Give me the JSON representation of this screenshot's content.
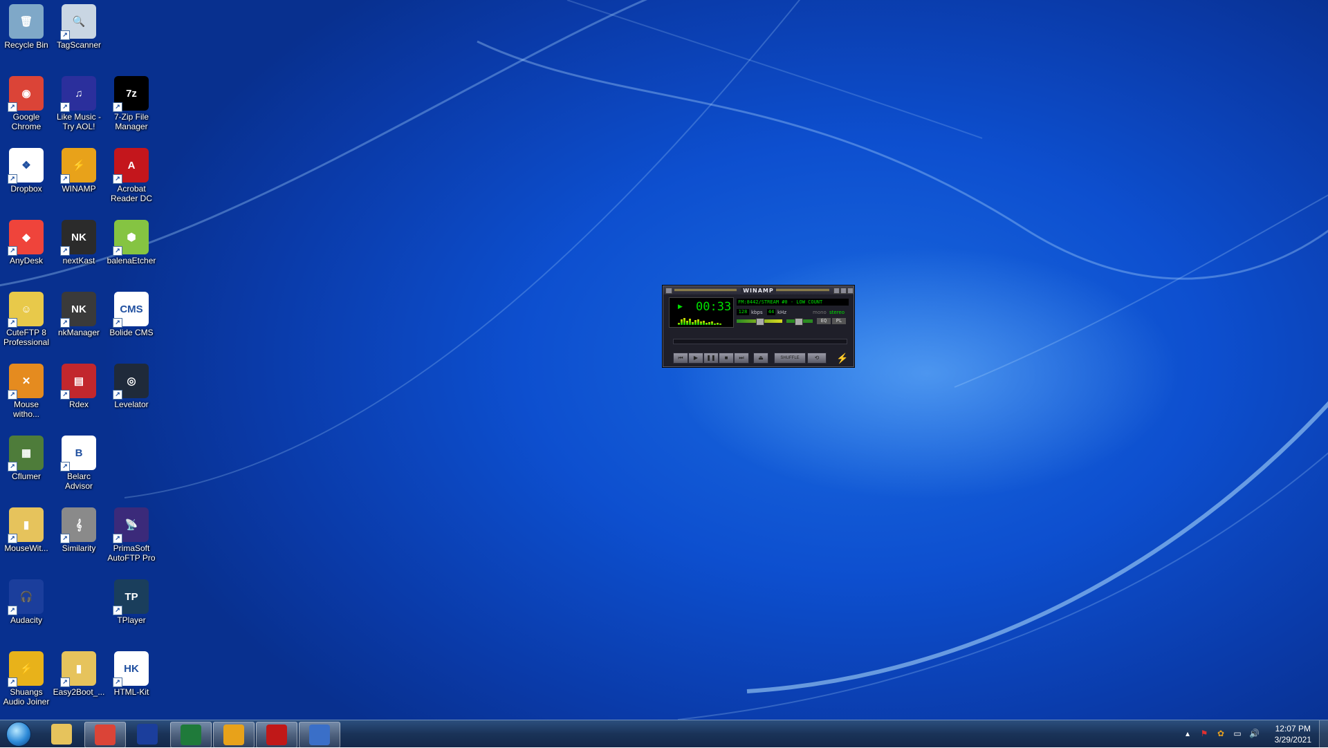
{
  "desktop_icons": [
    {
      "label": "Recycle Bin",
      "icon": "recycle-bin-icon",
      "color": "#7fa8c8",
      "glyph": "🗑"
    },
    {
      "label": "TagScanner",
      "icon": "magnifier-icon",
      "color": "#c9d6e3",
      "glyph": "🔍"
    },
    {
      "label": "Google Chrome",
      "icon": "chrome-icon",
      "color": "#db4437",
      "glyph": "◉"
    },
    {
      "label": "Like Music - Try AOL!",
      "icon": "music-notes-icon",
      "color": "#2b2f9c",
      "glyph": "♫"
    },
    {
      "label": "7-Zip File Manager",
      "icon": "7zip-icon",
      "color": "#000000",
      "glyph": "7z"
    },
    {
      "label": "Dropbox",
      "icon": "dropbox-icon",
      "color": "#ffffff",
      "glyph": "❖"
    },
    {
      "label": "WINAMP",
      "icon": "winamp-bolt-icon",
      "color": "#e8a21a",
      "glyph": "⚡"
    },
    {
      "label": "Acrobat Reader DC",
      "icon": "acrobat-icon",
      "color": "#c4161c",
      "glyph": "A"
    },
    {
      "label": "AnyDesk",
      "icon": "anydesk-icon",
      "color": "#ef443b",
      "glyph": "◆"
    },
    {
      "label": "nextKast",
      "icon": "nextkast-icon",
      "color": "#2b2b2b",
      "glyph": "NK"
    },
    {
      "label": "balenaEtcher",
      "icon": "cube-icon",
      "color": "#85c442",
      "glyph": "⬢"
    },
    {
      "label": "CuteFTP 8 Professional",
      "icon": "cuteftp-icon",
      "color": "#e8c94a",
      "glyph": "☺"
    },
    {
      "label": "nkManager",
      "icon": "nkmanager-icon",
      "color": "#3a3a3a",
      "glyph": "NK"
    },
    {
      "label": "Bolide CMS",
      "icon": "bolide-cms-icon",
      "color": "#ffffff",
      "glyph": "CMS"
    },
    {
      "label": "Mouse witho...",
      "icon": "mouse-without-borders-icon",
      "color": "#e58b1f",
      "glyph": "✕"
    },
    {
      "label": "Rdex",
      "icon": "rdex-icon",
      "color": "#c2272d",
      "glyph": "▤"
    },
    {
      "label": "Levelator",
      "icon": "levelator-icon",
      "color": "#1f2a3a",
      "glyph": "◎"
    },
    {
      "label": "Cflumer",
      "icon": "cflumer-icon",
      "color": "#4e7c3a",
      "glyph": "▦"
    },
    {
      "label": "Belarc Advisor",
      "icon": "belarc-icon",
      "color": "#ffffff",
      "glyph": "B"
    },
    {
      "label": "MouseWit...",
      "icon": "folder-icon",
      "color": "#e6c35c",
      "glyph": "▮"
    },
    {
      "label": "Similarity",
      "icon": "treble-clef-icon",
      "color": "#8a8a8a",
      "glyph": "𝄞"
    },
    {
      "label": "PrimaSoft AutoFTP Pro",
      "icon": "satellite-dish-icon",
      "color": "#3b2a7a",
      "glyph": "📡"
    },
    {
      "label": "Audacity",
      "icon": "audacity-icon",
      "color": "#1b3e9c",
      "glyph": "🎧"
    },
    {
      "label": "TPlayer",
      "icon": "tplayer-icon",
      "color": "#1a3e5c",
      "glyph": "TP"
    },
    {
      "label": "Shuangs Audio Joiner",
      "icon": "audio-joiner-icon",
      "color": "#e8b21a",
      "glyph": "⚡"
    },
    {
      "label": "Easy2Boot_...",
      "icon": "folder-icon",
      "color": "#e6c35c",
      "glyph": "▮"
    },
    {
      "label": "HTML-Kit",
      "icon": "html-kit-icon",
      "color": "#ffffff",
      "glyph": "HK"
    }
  ],
  "winamp": {
    "title": "WINAMP",
    "time": "00:33",
    "song": "FM:8442/STREAM #0 -  LOW COUNT",
    "kbps_value": "128",
    "kbps_label": "kbps",
    "khz_value": "44",
    "khz_label": "kHz",
    "mono": "mono",
    "stereo": "stereo",
    "eq": "EQ",
    "pl": "PL",
    "shuffle": "SHUFFLE",
    "controls": [
      "prev",
      "play",
      "pause",
      "stop",
      "next"
    ]
  },
  "taskbar": {
    "pinned": [
      {
        "name": "explorer",
        "icon": "folder-icon",
        "color": "#e6c35c"
      },
      {
        "name": "chrome",
        "icon": "chrome-icon",
        "color": "#db4437"
      },
      {
        "name": "audacity",
        "icon": "audacity-icon",
        "color": "#1b3e9c"
      },
      {
        "name": "excel",
        "icon": "excel-icon",
        "color": "#1f7a3a"
      },
      {
        "name": "winamp",
        "icon": "winamp-bolt-icon",
        "color": "#e8a21a"
      },
      {
        "name": "cherry",
        "icon": "cherry-icon",
        "color": "#c01818"
      },
      {
        "name": "remote",
        "icon": "computer-icon",
        "color": "#3a6fc8"
      }
    ],
    "clock": {
      "time": "12:07 PM",
      "date": "3/29/2021"
    }
  },
  "colors": {
    "desktop": "#0d4fcf",
    "taskbar": "#1a3358"
  }
}
